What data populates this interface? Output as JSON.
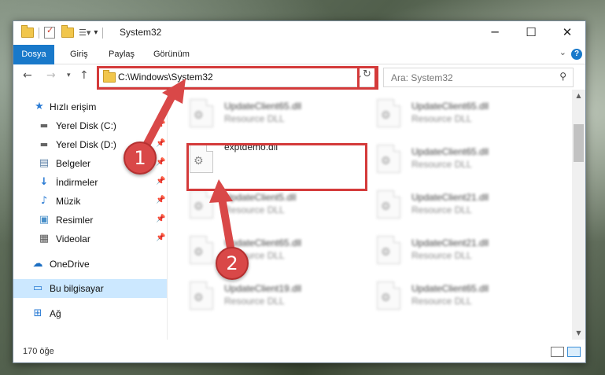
{
  "window": {
    "title": "System32",
    "minimize": "─",
    "maximize": "☐",
    "close": "✕"
  },
  "ribbon": {
    "tabs": [
      "Dosya",
      "Giriş",
      "Paylaş",
      "Görünüm"
    ],
    "help": "?"
  },
  "address": {
    "path": "C:\\Windows\\System32",
    "search_placeholder": "Ara: System32"
  },
  "nav": {
    "items": [
      {
        "label": "Hızlı erişim",
        "icon": "star-icon"
      },
      {
        "label": "Yerel Disk (C:)",
        "icon": "drive-icon"
      },
      {
        "label": "Yerel Disk (D:)",
        "icon": "drive-icon"
      },
      {
        "label": "Belgeler",
        "icon": "document-icon"
      },
      {
        "label": "İndirmeler",
        "icon": "download-icon"
      },
      {
        "label": "Müzik",
        "icon": "music-icon"
      },
      {
        "label": "Resimler",
        "icon": "picture-icon"
      },
      {
        "label": "Videolar",
        "icon": "video-icon"
      },
      {
        "label": "OneDrive",
        "icon": "cloud-icon"
      },
      {
        "label": "Bu bilgisayar",
        "icon": "computer-icon"
      },
      {
        "label": "Ağ",
        "icon": "network-icon"
      }
    ]
  },
  "files": [
    {
      "name": "UpdateClient65.dll",
      "type": "Resource DLL"
    },
    {
      "name": "UpdateClient65.dll",
      "type": "Resource DLL"
    },
    {
      "name": "exptdemo.dll",
      "type": ""
    },
    {
      "name": "UpdateClient65.dll",
      "type": "Resource DLL"
    },
    {
      "name": "UpdateClient5.dll",
      "type": "Resource DLL"
    },
    {
      "name": "UpdateClient21.dll",
      "type": "Resource DLL"
    },
    {
      "name": "UpdateClient65.dll",
      "type": "Resource DLL"
    },
    {
      "name": "UpdateClient21.dll",
      "type": "Resource DLL"
    },
    {
      "name": "UpdateClient19.dll",
      "type": "Resource DLL"
    },
    {
      "name": "UpdateClient65.dll",
      "type": "Resource DLL"
    }
  ],
  "status": {
    "item_count": "170 öğe"
  },
  "callouts": [
    "1",
    "2"
  ],
  "colors": {
    "accent": "#1979ca",
    "highlight": "#d43a3a",
    "selected_nav": "#cce8ff"
  }
}
